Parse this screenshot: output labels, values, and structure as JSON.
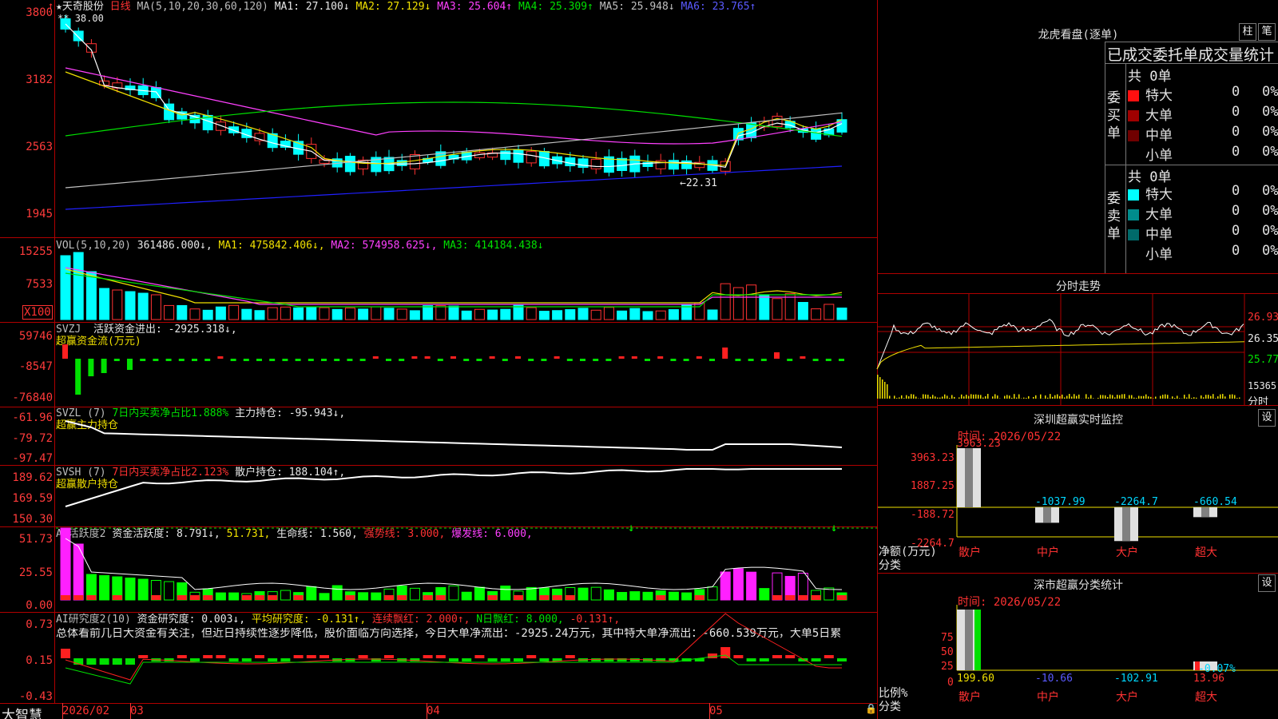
{
  "main": {
    "name": "天奇股份",
    "period": "日线",
    "ma_label": "MA(5,10,20,30,60,120)",
    "ma_values": [
      {
        "label": "MA1: 27.100↓",
        "color": "#e8e8e8"
      },
      {
        "label": "MA2: 27.129↓",
        "color": "#f0e000"
      },
      {
        "label": "MA3: 25.604↑",
        "color": "#ff40ff"
      },
      {
        "label": "MA4: 25.309↑",
        "color": "#00e000"
      },
      {
        "label": "MA5: 25.948↓",
        "color": "#c0c0c0"
      },
      {
        "label": "MA6: 23.765↑",
        "color": "#5a5aff"
      }
    ],
    "axis": [
      "3800",
      "3182",
      "2563",
      "1945"
    ],
    "high_label": "38.00",
    "low_label": "←22.31"
  },
  "vol": {
    "label": "VOL(5,10,20)",
    "value": "361486.000↓,",
    "ma1": "MA1: 475842.406↓,",
    "ma2": "MA2: 574958.625↓,",
    "ma3": "MA3: 414184.438↓",
    "axis": [
      "15255",
      "7533"
    ],
    "unit": "X100"
  },
  "svzj": {
    "label": "SVZJ",
    "text": "活跃资金进出: -2925.318↓,",
    "sub": "超赢资金流(万元)",
    "axis": [
      "59746",
      "-8547",
      "-76840"
    ]
  },
  "svzl": {
    "label": "SVZL (7)",
    "text1": "7日内买卖净占比1.888%",
    "text2": "主力持仓: -95.943↓,",
    "sub": "超赢主力持仓",
    "axis": [
      "-61.96",
      "-79.72",
      "-97.47"
    ]
  },
  "svsh": {
    "label": "SVSH (7)",
    "text1": "7日内买卖净占比2.123%",
    "text2": "散户持仓: 188.104↑,",
    "sub": "超赢散户持仓",
    "axis": [
      "189.62",
      "169.59",
      "150.30"
    ]
  },
  "ai1": {
    "label": "AI活跃度2",
    "t1": "资金活跃度: 8.791↓,",
    "t2": "51.731,",
    "t3": "生命线: 1.560,",
    "t4": "强势线: 3.000,",
    "t5": "爆发线: 6.000,",
    "axis": [
      "51.73",
      "25.55",
      "0.00"
    ]
  },
  "ai2": {
    "label": "AI研究度2(10)",
    "t1": "资金研究度: 0.003↓,",
    "t2": "平均研究度: -0.131↑,",
    "t3": "连续飘红: 2.000↑,",
    "t4": "N日飘红: 8.000,",
    "t5": "-0.131↑,",
    "comment": "总体看前几日大资金有关注，但近日持续性逐步降低，股价面临方向选择，今日大单净流出：-2925.24万元，其中特大单净流出：-660.539万元，大单5日累",
    "axis": [
      "0.73",
      "0.15",
      "-0.43"
    ]
  },
  "dates": [
    "2026/02",
    "03",
    "04",
    "05"
  ],
  "bottom_label": "大智慧",
  "lhb": {
    "title": "龙虎看盘(逐单)",
    "btn1": "柱",
    "btn2": "笔",
    "header": "已成交委托单成交量统计",
    "buy_label": "委买单",
    "sell_label": "委卖单",
    "buy_total": "共 0单",
    "sell_total": "共 0单",
    "buy_rows": [
      {
        "name": "特大",
        "val": "0",
        "pct": "0%",
        "color": "#ff1010"
      },
      {
        "name": "大单",
        "val": "0",
        "pct": "0%",
        "color": "#a00000"
      },
      {
        "name": "中单",
        "val": "0",
        "pct": "0%",
        "color": "#700000"
      },
      {
        "name": "小单",
        "val": "0",
        "pct": "0%",
        "color": "#000000"
      }
    ],
    "sell_rows": [
      {
        "name": "特大",
        "val": "0",
        "pct": "0%",
        "color": "#00ffff"
      },
      {
        "name": "大单",
        "val": "0",
        "pct": "0%",
        "color": "#008c8c"
      },
      {
        "name": "中单",
        "val": "0",
        "pct": "0%",
        "color": "#006a6a"
      },
      {
        "name": "小单",
        "val": "0",
        "pct": "0%",
        "color": "#000000"
      }
    ]
  },
  "fenshi": {
    "title": "分时走势",
    "axis": [
      "26.93",
      "26.35",
      "25.77"
    ],
    "vol_label": "15365",
    "unit": "分时"
  },
  "sz_monitor": {
    "title": "深圳超赢实时监控",
    "btn": "设",
    "time": "时间: 2026/05/22",
    "axis": [
      "3963.23",
      "1887.25",
      "-188.72",
      "-2264.7"
    ],
    "ylabel": "净额(万元)",
    "xlabel": "分类",
    "bars": [
      {
        "name": "散户",
        "value": "3963.23"
      },
      {
        "name": "中户",
        "value": "-1037.99"
      },
      {
        "name": "大户",
        "value": "-2264.7"
      },
      {
        "name": "超大",
        "value": "-660.54"
      }
    ]
  },
  "sz_class": {
    "title": "深市超赢分类统计",
    "btn": "设",
    "time": "时间: 2026/05/22",
    "axis": [
      "75",
      "50",
      "25",
      "0"
    ],
    "ylabel": "比例%",
    "xlabel": "分类",
    "annotation": "-0.07%",
    "bars": [
      {
        "name": "散户",
        "value": "199.60"
      },
      {
        "name": "中户",
        "value": "-10.66"
      },
      {
        "name": "大户",
        "value": "-102.91"
      },
      {
        "name": "超大",
        "value": "13.96"
      }
    ]
  }
}
